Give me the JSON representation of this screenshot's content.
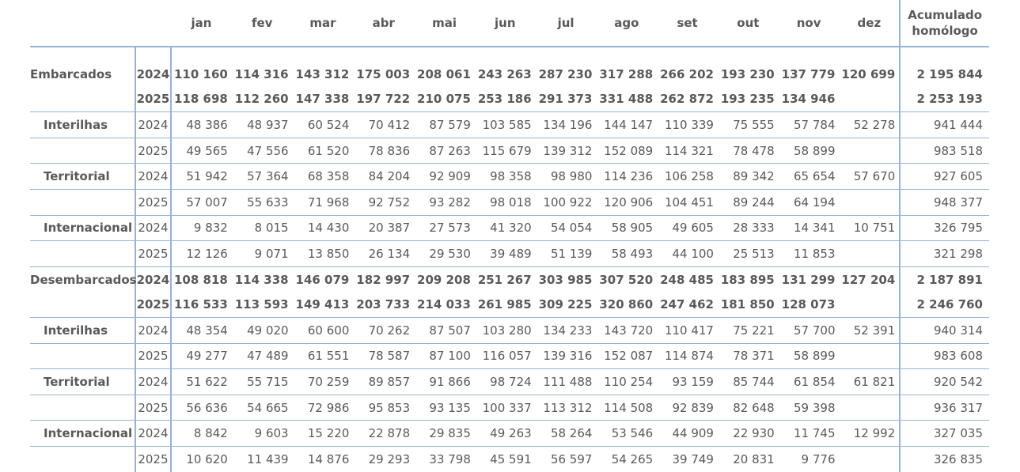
{
  "header": {
    "months": [
      "jan",
      "fev",
      "mar",
      "abr",
      "mai",
      "jun",
      "jul",
      "ago",
      "set",
      "out",
      "nov",
      "dez"
    ],
    "accum_line1": "Acumulado",
    "accum_line2": "homólogo"
  },
  "rows": [
    {
      "label": "Embarcados",
      "sub": false,
      "bold": true,
      "border": false,
      "year": "2024",
      "values": [
        "110 160",
        "114 316",
        "143 312",
        "175 003",
        "208 061",
        "243 263",
        "287 230",
        "317 288",
        "266 202",
        "193 230",
        "137 779",
        "120 699"
      ],
      "acc": "2 195 844"
    },
    {
      "label": "",
      "sub": false,
      "bold": true,
      "border": true,
      "year": "2025",
      "values": [
        "118 698",
        "112 260",
        "147 338",
        "197 722",
        "210 075",
        "253 186",
        "291 373",
        "331 488",
        "262 872",
        "193 235",
        "134 946",
        ""
      ],
      "acc": "2 253 193"
    },
    {
      "label": "Interilhas",
      "sub": true,
      "bold": false,
      "border": true,
      "year": "2024",
      "values": [
        "48 386",
        "48 937",
        "60 524",
        "70 412",
        "87 579",
        "103 585",
        "134 196",
        "144 147",
        "110 339",
        "75 555",
        "57 784",
        "52 278"
      ],
      "acc": "941 444"
    },
    {
      "label": "",
      "sub": true,
      "bold": false,
      "border": true,
      "year": "2025",
      "values": [
        "49 565",
        "47 556",
        "61 520",
        "78 836",
        "87 263",
        "115 679",
        "139 312",
        "152 089",
        "114 321",
        "78 478",
        "58 899",
        ""
      ],
      "acc": "983 518"
    },
    {
      "label": "Territorial",
      "sub": true,
      "bold": false,
      "border": true,
      "year": "2024",
      "values": [
        "51 942",
        "57 364",
        "68 358",
        "84 204",
        "92 909",
        "98 358",
        "98 980",
        "114 236",
        "106 258",
        "89 342",
        "65 654",
        "57 670"
      ],
      "acc": "927 605"
    },
    {
      "label": "",
      "sub": true,
      "bold": false,
      "border": true,
      "year": "2025",
      "values": [
        "57 007",
        "55 633",
        "71 968",
        "92 752",
        "93 282",
        "98 018",
        "100 922",
        "120 906",
        "104 451",
        "89 244",
        "64 194",
        ""
      ],
      "acc": "948 377"
    },
    {
      "label": "Internacional",
      "sub": true,
      "bold": false,
      "border": true,
      "year": "2024",
      "values": [
        "9 832",
        "8 015",
        "14 430",
        "20 387",
        "27 573",
        "41 320",
        "54 054",
        "58 905",
        "49 605",
        "28 333",
        "14 341",
        "10 751"
      ],
      "acc": "326 795"
    },
    {
      "label": "",
      "sub": true,
      "bold": false,
      "border": true,
      "year": "2025",
      "values": [
        "12 126",
        "9 071",
        "13 850",
        "26 134",
        "29 530",
        "39 489",
        "51 139",
        "58 493",
        "44 100",
        "25 513",
        "11 853",
        ""
      ],
      "acc": "321 298"
    },
    {
      "label": "Desembarcados",
      "sub": false,
      "bold": true,
      "border": false,
      "year": "2024",
      "values": [
        "108 818",
        "114 338",
        "146 079",
        "182 997",
        "209 208",
        "251 267",
        "303 985",
        "307 520",
        "248 485",
        "183 895",
        "131 299",
        "127 204"
      ],
      "acc": "2 187 891"
    },
    {
      "label": "",
      "sub": false,
      "bold": true,
      "border": true,
      "year": "2025",
      "values": [
        "116 533",
        "113 593",
        "149 413",
        "203 733",
        "214 033",
        "261 985",
        "309 225",
        "320 860",
        "247 462",
        "181 850",
        "128 073",
        ""
      ],
      "acc": "2 246 760"
    },
    {
      "label": "Interilhas",
      "sub": true,
      "bold": false,
      "border": true,
      "year": "2024",
      "values": [
        "48 354",
        "49 020",
        "60 600",
        "70 262",
        "87 507",
        "103 280",
        "134 233",
        "143 720",
        "110 417",
        "75 221",
        "57 700",
        "52 391"
      ],
      "acc": "940 314"
    },
    {
      "label": "",
      "sub": true,
      "bold": false,
      "border": true,
      "year": "2025",
      "values": [
        "49 277",
        "47 489",
        "61 551",
        "78 587",
        "87 100",
        "116 057",
        "139 316",
        "152 087",
        "114 874",
        "78 371",
        "58 899",
        ""
      ],
      "acc": "983 608"
    },
    {
      "label": "Territorial",
      "sub": true,
      "bold": false,
      "border": true,
      "year": "2024",
      "values": [
        "51 622",
        "55 715",
        "70 259",
        "89 857",
        "91 866",
        "98 724",
        "111 488",
        "110 254",
        "93 159",
        "85 744",
        "61 854",
        "61 821"
      ],
      "acc": "920 542"
    },
    {
      "label": "",
      "sub": true,
      "bold": false,
      "border": true,
      "year": "2025",
      "values": [
        "56 636",
        "54 665",
        "72 986",
        "95 853",
        "93 135",
        "100 337",
        "113 312",
        "114 508",
        "92 839",
        "82 648",
        "59 398",
        ""
      ],
      "acc": "936 317"
    },
    {
      "label": "Internacional",
      "sub": true,
      "bold": false,
      "border": true,
      "year": "2024",
      "values": [
        "8 842",
        "9 603",
        "15 220",
        "22 878",
        "29 835",
        "49 263",
        "58 264",
        "53 546",
        "44 909",
        "22 930",
        "11 745",
        "12 992"
      ],
      "acc": "327 035"
    },
    {
      "label": "",
      "sub": true,
      "bold": false,
      "border": false,
      "year": "2025",
      "values": [
        "10 620",
        "11 439",
        "14 876",
        "29 293",
        "33 798",
        "45 591",
        "56 597",
        "54 265",
        "39 749",
        "20 831",
        "9 776",
        ""
      ],
      "acc": "326 835"
    }
  ]
}
